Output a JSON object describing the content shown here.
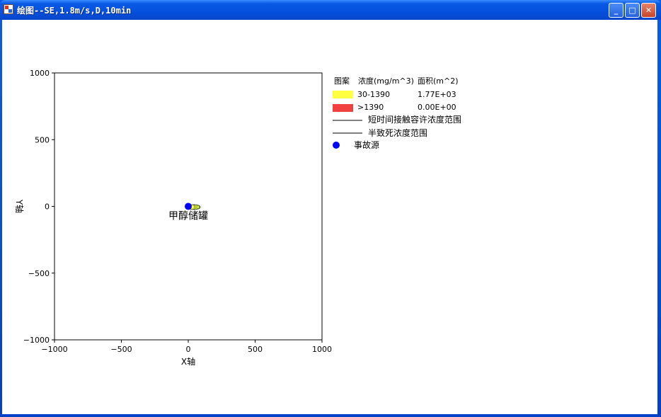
{
  "window": {
    "title": "绘图--SE,1.8m/s,D,10min",
    "minimize_glyph": "_",
    "maximize_glyph": "□",
    "close_glyph": "✕"
  },
  "chart_data": {
    "type": "scatter",
    "xlabel": "X轴",
    "ylabel": "Y轴",
    "xlim": [
      -1000,
      1000
    ],
    "ylim": [
      -1000,
      1000
    ],
    "xticks": [
      -1000,
      -500,
      0,
      500,
      1000
    ],
    "yticks": [
      -1000,
      -500,
      0,
      500,
      1000
    ],
    "x_tick_labels": [
      "−1000",
      "−500",
      "0",
      "500",
      "1000"
    ],
    "y_tick_labels": [
      "−1000",
      "−500",
      "0",
      "500",
      "1000"
    ],
    "grid": false,
    "source": {
      "x": 0,
      "y": 0,
      "label": "甲醇储罐",
      "color": "#0000ff"
    },
    "contour_label": "30",
    "legend": {
      "headers": [
        "图案",
        "浓度(mg/m^3)",
        "面积(m^2)"
      ],
      "rows": [
        {
          "color": "#ffff40",
          "range": "30-1390",
          "area": "1.77E+03"
        },
        {
          "color": "#f04040",
          "range": ">1390",
          "area": "0.00E+00"
        }
      ],
      "lines": [
        "短时间接触容许浓度范围",
        "半致死浓度范围"
      ],
      "source_label": "事故源",
      "source_color": "#0000ff"
    }
  }
}
